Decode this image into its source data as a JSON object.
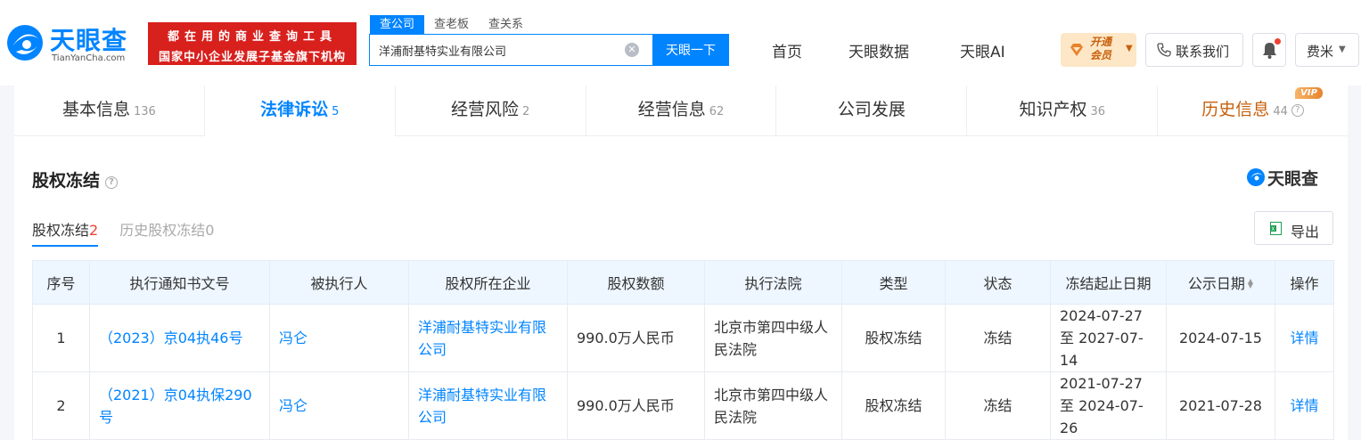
{
  "header": {
    "logo_cn": "天眼查",
    "logo_en": "TianYanCha.com",
    "banner_line1": "都在用的商业查询工具",
    "banner_line2": "国家中小企业发展子基金旗下机构",
    "search_tabs": [
      {
        "label": "查公司",
        "active": true
      },
      {
        "label": "查老板",
        "active": false
      },
      {
        "label": "查关系",
        "active": false
      }
    ],
    "search_value": "洋浦耐基特实业有限公司",
    "search_button": "天眼一下",
    "nav": [
      "首页",
      "天眼数据",
      "天眼AI"
    ],
    "vip_line1": "开通",
    "vip_line2": "会员",
    "contact": "联系我们",
    "user": "费米"
  },
  "main_tabs": [
    {
      "label": "基本信息",
      "count": "136"
    },
    {
      "label": "法律诉讼",
      "count": "5"
    },
    {
      "label": "经营风险",
      "count": "2"
    },
    {
      "label": "经营信息",
      "count": "62"
    },
    {
      "label": "公司发展",
      "count": ""
    },
    {
      "label": "知识产权",
      "count": "36"
    },
    {
      "label": "历史信息",
      "count": "44",
      "badge": "VIP"
    }
  ],
  "section": {
    "title": "股权冻结",
    "brand": "天眼查",
    "sub_tabs": [
      {
        "label": "股权冻结",
        "count": "2"
      },
      {
        "label": "历史股权冻结",
        "count": "0"
      }
    ],
    "export": "导出"
  },
  "table": {
    "columns": [
      "序号",
      "执行通知书文号",
      "被执行人",
      "股权所在企业",
      "股权数额",
      "执行法院",
      "类型",
      "状态",
      "冻结起止日期",
      "公示日期",
      "操作"
    ],
    "rows": [
      {
        "no": "1",
        "doc": "（2023）京04执46号",
        "person": "冯仑",
        "company": "洋浦耐基特实业有限公司",
        "amount": "990.0万人民币",
        "court": "北京市第四中级人民法院",
        "type": "股权冻结",
        "status": "冻结",
        "range": "2024-07-27 至 2027-07-14",
        "date": "2024-07-15",
        "action": "详情"
      },
      {
        "no": "2",
        "doc": "（2021）京04执保290号",
        "person": "冯仑",
        "company": "洋浦耐基特实业有限公司",
        "amount": "990.0万人民币",
        "court": "北京市第四中级人民法院",
        "type": "股权冻结",
        "status": "冻结",
        "range": "2021-07-27 至 2024-07-26",
        "date": "2021-07-28",
        "action": "详情"
      }
    ]
  }
}
